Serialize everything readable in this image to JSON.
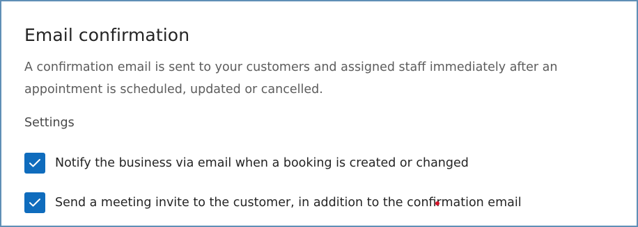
{
  "section": {
    "title": "Email confirmation",
    "description": "A confirmation email is sent to your customers and assigned staff immediately after an appointment is scheduled, updated or cancelled.",
    "settings_heading": "Settings"
  },
  "options": [
    {
      "label": "Notify the business via email when a booking is created or changed",
      "checked": true
    },
    {
      "label": "Send a meeting invite to the customer, in addition to the confirmation email",
      "checked": true
    }
  ],
  "colors": {
    "border": "#5f8fb6",
    "checkbox_fill": "#0f6cbd",
    "text_primary": "#242424",
    "text_secondary": "#5c5c5c",
    "marker": "#d4142a"
  },
  "icons": {
    "checkbox_checked": "checkmark-icon"
  }
}
